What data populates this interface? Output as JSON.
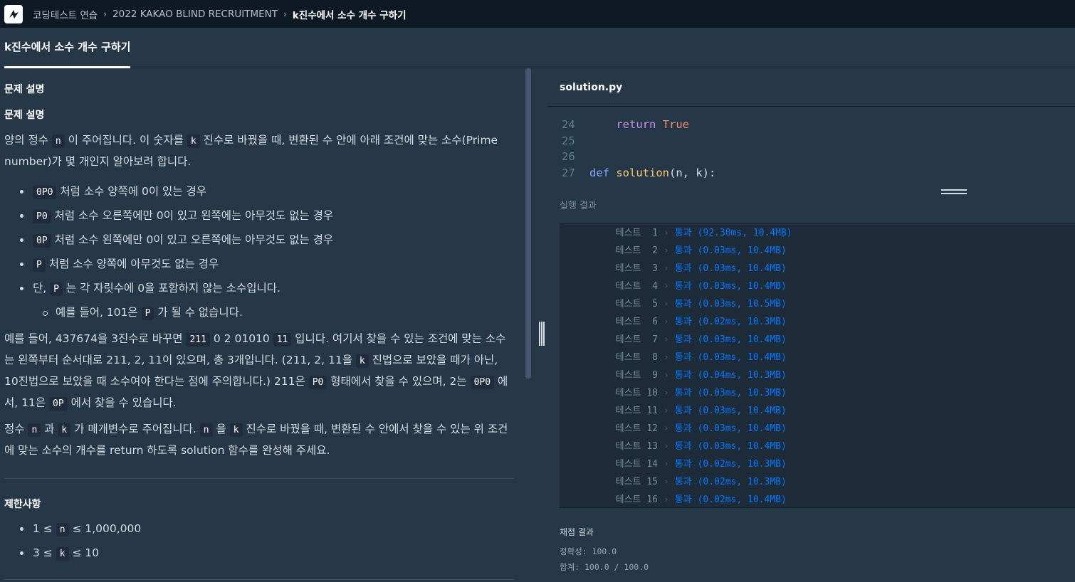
{
  "breadcrumb": {
    "items": [
      "코딩테스트 연습",
      "2022 KAKAO BLIND RECRUITMENT",
      "k진수에서 소수 개수 구하기"
    ]
  },
  "tab": {
    "label": "k진수에서 소수 개수 구하기"
  },
  "problem": {
    "section1": "문제 설명",
    "section1b": "문제 설명",
    "intro": {
      "t1": "양의 정수 ",
      "c1": "n",
      "t2": " 이 주어집니다. 이 숫자를 ",
      "c2": "k",
      "t3": " 진수로 바꿨을 때, 변환된 수 안에 아래 조건에 맞는 소수(Prime number)가 몇 개인지 알아보려 합니다."
    },
    "bullets": [
      {
        "code": "0P0",
        "text": " 처럼 소수 양쪽에 0이 있는 경우"
      },
      {
        "code": "P0",
        "text": " 처럼 소수 오른쪽에만 0이 있고 왼쪽에는 아무것도 없는 경우"
      },
      {
        "code": "0P",
        "text": " 처럼 소수 왼쪽에만 0이 있고 오른쪽에는 아무것도 없는 경우"
      },
      {
        "code": "P",
        "text": " 처럼 소수 양쪽에 아무것도 없는 경우"
      },
      {
        "pre": "단, ",
        "code": "P",
        "text": " 는 각 자릿수에 0을 포함하지 않는 소수입니다."
      }
    ],
    "subbullet": {
      "pre": "예를 들어, 101은 ",
      "code": "P",
      "text": " 가 될 수 없습니다."
    },
    "example": {
      "t1": "예를 들어, 437674을 3진수로 바꾸면 ",
      "c1": "211",
      "t2": " 0 2 ",
      "t2b": "01010",
      "c2": "11",
      "t3": " 입니다. 여기서 찾을 수 있는 조건에 맞는 소수는 왼쪽부터 순서대로 211, 2, 11이 있으며, 총 3개입니다. (211, 2, 11을 ",
      "c3": "k",
      "t4": " 진법으로 보았을 때가 아닌, 10진법으로 보았을 때 소수여야 한다는 점에 주의합니다.) 211은 ",
      "c4": "P0",
      "t5": " 형태에서 찾을 수 있으며, 2는 ",
      "c5": "0P0",
      "t6": " 에서, 11은 ",
      "c6": "0P",
      "t7": " 에서 찾을 수 있습니다."
    },
    "task": {
      "t1": "정수 ",
      "c1": "n",
      "t2": " 과 ",
      "c2": "k",
      "t3": " 가 매개변수로 주어집니다. ",
      "c3": "n",
      "t4": " 을 ",
      "c4": "k",
      "t5": " 진수로 바꿨을 때, 변환된 수 안에서 찾을 수 있는 위 조건에 맞는 소수의 개수를 return 하도록 solution 함수를 완성해 주세요."
    },
    "constraints_title": "제한사항",
    "constraints": [
      {
        "pre": "1 ≤ ",
        "code": "n",
        "text": " ≤ 1,000,000"
      },
      {
        "pre": "3 ≤ ",
        "code": "k",
        "text": " ≤ 10"
      }
    ]
  },
  "editor": {
    "filename": "solution.py",
    "lines": [
      {
        "num": "24",
        "indent": "    ",
        "kw": "return",
        "rest": " ",
        "lit": "True"
      },
      {
        "num": "25"
      },
      {
        "num": "26"
      },
      {
        "num": "27",
        "kw": "def",
        "rest": " ",
        "fn": "solution",
        "args": "(n, k):"
      }
    ]
  },
  "results": {
    "label": "실행 결과",
    "rows": [
      {
        "name": "테스트  1",
        "status": "통과",
        "detail": " (92.30ms, 10.4MB)"
      },
      {
        "name": "테스트  2",
        "status": "통과",
        "detail": " (0.03ms, 10.4MB)"
      },
      {
        "name": "테스트  3",
        "status": "통과",
        "detail": " (0.03ms, 10.4MB)"
      },
      {
        "name": "테스트  4",
        "status": "통과",
        "detail": " (0.03ms, 10.4MB)"
      },
      {
        "name": "테스트  5",
        "status": "통과",
        "detail": " (0.03ms, 10.5MB)"
      },
      {
        "name": "테스트  6",
        "status": "통과",
        "detail": " (0.02ms, 10.3MB)"
      },
      {
        "name": "테스트  7",
        "status": "통과",
        "detail": " (0.03ms, 10.4MB)"
      },
      {
        "name": "테스트  8",
        "status": "통과",
        "detail": " (0.03ms, 10.4MB)"
      },
      {
        "name": "테스트  9",
        "status": "통과",
        "detail": " (0.04ms, 10.3MB)"
      },
      {
        "name": "테스트 10",
        "status": "통과",
        "detail": " (0.03ms, 10.3MB)"
      },
      {
        "name": "테스트 11",
        "status": "통과",
        "detail": " (0.03ms, 10.4MB)"
      },
      {
        "name": "테스트 12",
        "status": "통과",
        "detail": " (0.03ms, 10.4MB)"
      },
      {
        "name": "테스트 13",
        "status": "통과",
        "detail": " (0.03ms, 10.4MB)"
      },
      {
        "name": "테스트 14",
        "status": "통과",
        "detail": " (0.02ms, 10.3MB)"
      },
      {
        "name": "테스트 15",
        "status": "통과",
        "detail": " (0.02ms, 10.3MB)"
      },
      {
        "name": "테스트 16",
        "status": "통과",
        "detail": " (0.02ms, 10.4MB)"
      }
    ],
    "grade_title": "채점 결과",
    "accuracy": "정확성: 100.0",
    "total": "합계: 100.0 / 100.0"
  },
  "colors": {
    "pass": "#0078ff",
    "nav_bg": "#0f1923",
    "panel_bg": "#263747"
  }
}
